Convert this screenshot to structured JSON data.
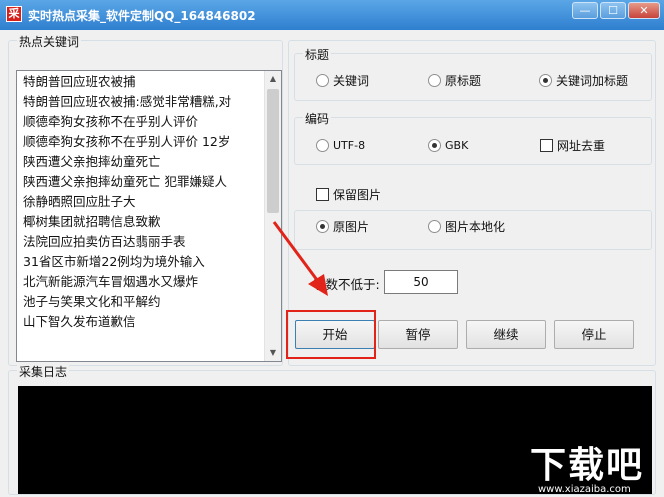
{
  "window": {
    "title": "实时热点采集_软件定制QQ_164846802",
    "min_glyph": "—",
    "max_glyph": "☐",
    "close_glyph": "✕",
    "app_icon_glyph": "采"
  },
  "keywords": {
    "label": "热点关键词",
    "items": [
      "特朗普回应班农被捕",
      "特朗普回应班农被捕:感觉非常糟糕,对",
      "顺德牵狗女孩称不在乎别人评价",
      "顺德牵狗女孩称不在乎别人评价 12岁",
      "陕西遭父亲抱摔幼童死亡",
      "陕西遭父亲抱摔幼童死亡 犯罪嫌疑人",
      "徐静晒照回应肚子大",
      "椰树集团就招聘信息致歉",
      "法院回应拍卖仿百达翡丽手表",
      "31省区市新增22例均为境外输入",
      "北汽新能源汽车冒烟遇水又爆炸",
      "池子与笑果文化和平解约",
      "山下智久发布道歉信"
    ]
  },
  "options": {
    "title_group": {
      "label": "标题",
      "options": [
        "关键词",
        "原标题",
        "关键词加标题"
      ],
      "selected": "关键词加标题"
    },
    "encoding_group": {
      "label": "编码",
      "options": [
        "UTF-8",
        "GBK"
      ],
      "selected": "GBK",
      "dedupe_label": "网址去重"
    },
    "keep_images_label": "保留图片",
    "image_group": {
      "options": [
        "原图片",
        "图片本地化"
      ],
      "selected": "原图片"
    },
    "min_words_label": "字数不低于:",
    "min_words_value": "50"
  },
  "buttons": {
    "start": "开始",
    "pause": "暂停",
    "resume": "继续",
    "stop": "停止"
  },
  "log": {
    "label": "采集日志"
  },
  "watermark": {
    "big": "下载吧",
    "small": "www.xiazaiba.com"
  },
  "colors": {
    "highlight": "#e2231a",
    "titlebar": "#2f7fd0"
  }
}
